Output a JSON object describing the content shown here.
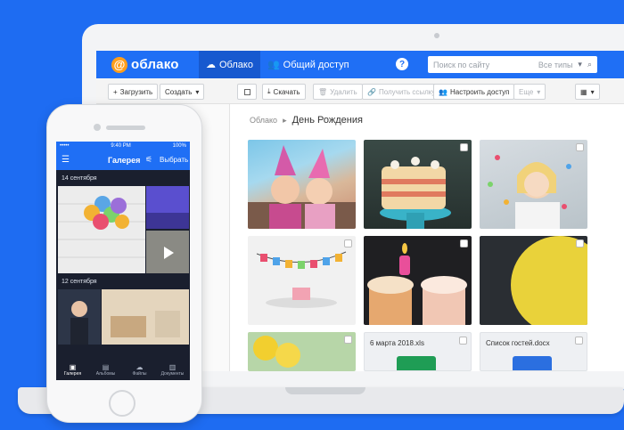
{
  "web": {
    "logo_text": "облако",
    "logo_symbol": "@",
    "tabs": [
      {
        "label": "Облако",
        "icon": "cloud-icon",
        "active": true
      },
      {
        "label": "Общий доступ",
        "icon": "users-icon",
        "active": false
      }
    ],
    "help_label": "?",
    "search": {
      "placeholder": "Поиск по сайту",
      "types_label": "Все типы"
    },
    "toolbar": {
      "upload": "Загрузить",
      "create": "Создать",
      "download": "Скачать",
      "delete": "Удалить",
      "get_link": "Получить ссылку",
      "share_settings": "Настроить доступ",
      "more": "Еще"
    },
    "breadcrumb": {
      "root": "Облако",
      "separator": "▸",
      "current": "День Рождения"
    },
    "files": [
      {
        "type": "photo",
        "name": "kids-party-hats-photo"
      },
      {
        "type": "photo",
        "name": "birthday-cake-photo"
      },
      {
        "type": "photo",
        "name": "girl-confetti-photo"
      },
      {
        "type": "photo",
        "name": "happy-birthday-banner-photo"
      },
      {
        "type": "photo",
        "name": "cupcakes-candle-photo"
      },
      {
        "type": "photo",
        "name": "yellow-balloon-photo"
      },
      {
        "type": "photo",
        "name": "balloons-photo"
      },
      {
        "type": "doc",
        "name": "6 марта 2018.xls",
        "icon": "X",
        "color": "#1f9d55"
      },
      {
        "type": "doc",
        "name": "Список гостей.docx",
        "icon": "W",
        "color": "#2b6fe0"
      }
    ]
  },
  "phone": {
    "status": {
      "signal": "•••••",
      "time": "9:40 PM",
      "battery": "100%"
    },
    "header": {
      "title": "Галерея",
      "select": "Выбрать"
    },
    "sections": [
      {
        "date": "14 сентября"
      },
      {
        "date": "12 сентября"
      }
    ],
    "tabbar": [
      {
        "label": "Галерея",
        "icon": "gallery-icon",
        "active": true
      },
      {
        "label": "Альбомы",
        "icon": "albums-icon",
        "active": false
      },
      {
        "label": "Файлы",
        "icon": "files-icon",
        "active": false
      },
      {
        "label": "Документы",
        "icon": "documents-icon",
        "active": false
      }
    ]
  },
  "colors": {
    "brand_blue": "#1f6ff5",
    "background": "#1e6cf2",
    "logo_orange": "#ff9e1b"
  }
}
